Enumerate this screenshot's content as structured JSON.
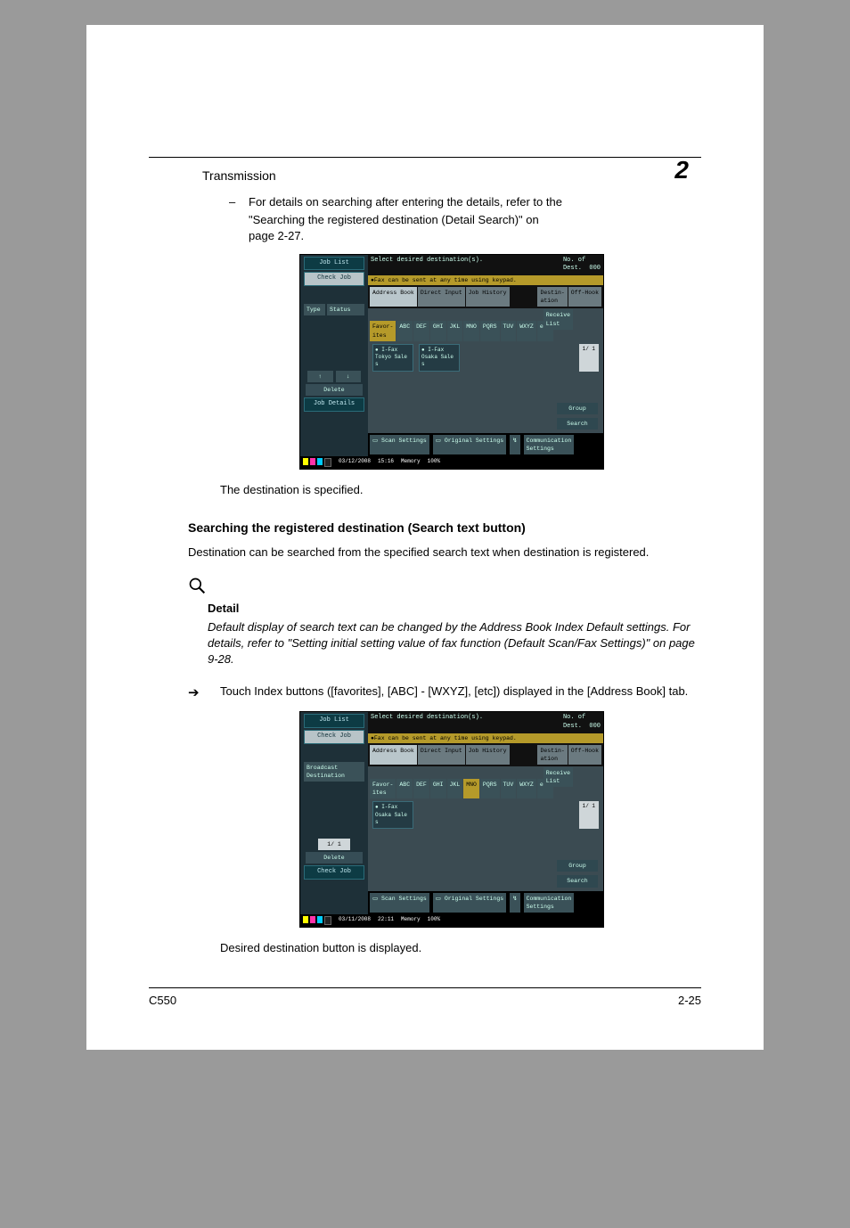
{
  "header": {
    "section": "Transmission",
    "chapter": "2"
  },
  "bullet1": {
    "dash": "–",
    "line1": "For details on searching after entering the details, refer to the",
    "line2": "\"Searching the registered destination (Detail Search)\" on",
    "line3": "page 2-27."
  },
  "after_fig1": "The destination is specified.",
  "sect_title": "Searching the registered destination (Search text button)",
  "sect_para": "Destination can be searched from the specified search text when destination is registered.",
  "detail": {
    "label": "Detail",
    "text": "Default display of search text can be changed by the Address Book Index Default settings. For details, refer to \"Setting initial setting value of fax function (Default Scan/Fax Settings)\" on page 9-28."
  },
  "arrow": {
    "sym": "➔",
    "text": "Touch Index buttons ([favorites], [ABC] - [WXYZ], [etc]) displayed in the [Address Book] tab."
  },
  "after_fig2": "Desired destination button is displayed.",
  "footer": {
    "model": "C550",
    "page": "2-25"
  },
  "fig": {
    "topbar": "Select desired destination(s).",
    "yellow": "●Fax can be sent at any time using keypad.",
    "left_btns": {
      "job_list": "Job List",
      "check_job": "Check Job",
      "status": "Status",
      "delete": "Delete",
      "job_details": "Job Details",
      "page_ind": "1/  1",
      "check_job2": "Check Job",
      "broadcast": "Broadcast\nDestination"
    },
    "tabs": {
      "addr": "Address Book",
      "direct": "Direct Input",
      "hist": "Job History",
      "dest_sett": "Destin-\nation",
      "offhook": "Off-Hook",
      "receive": "Receive\nList"
    },
    "index": {
      "fav": "Favor-\nites",
      "abc": "ABC",
      "def": "DEF",
      "ghi": "GHI",
      "jkl": "JKL",
      "mno": "MNO",
      "pqrs": "PQRS",
      "tuv": "TUV",
      "wxyz": "WXYZ",
      "etc": "etc"
    },
    "dest1": {
      "l1": "● I-Fax",
      "l2": "Tokyo Sale",
      "l3": "s"
    },
    "dest2": {
      "l1": "● I-Fax",
      "l2": "Osaka Sale",
      "l3": "s"
    },
    "page": "1/  1",
    "right": {
      "group": "Group",
      "search": "Search"
    },
    "bottom": {
      "scan": "Scan Settings",
      "orig": "Original Settings",
      "comm": "Communication\nSettings"
    },
    "status1": {
      "date": "03/12/2008",
      "time": "15:16",
      "mem": "Memory",
      "memv": "100%",
      "dest": "No. of\nDest.",
      "destv": "000"
    },
    "status2": {
      "date": "03/11/2008",
      "time": "22:11",
      "mem": "Memory",
      "memv": "100%",
      "dest": "No. of\nDest.",
      "destv": "000"
    }
  }
}
